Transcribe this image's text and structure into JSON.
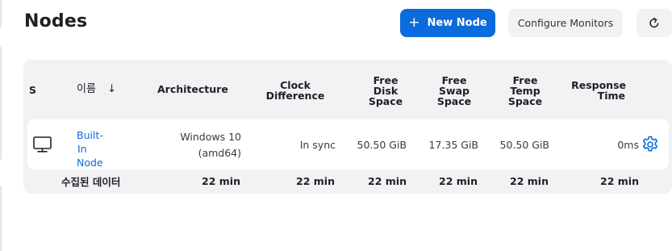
{
  "page": {
    "title": "Nodes"
  },
  "toolbar": {
    "new_node_label": "New Node",
    "new_node_icon": "plus-icon",
    "configure_monitors_label": "Configure Monitors",
    "refresh_icon": "refresh-icon"
  },
  "table": {
    "headers": {
      "status": "S",
      "name": "이름",
      "name_sort": "↓",
      "architecture": "Architecture",
      "clock_difference": [
        "Clock",
        "Difference"
      ],
      "free_disk_space": [
        "Free",
        "Disk",
        "Space"
      ],
      "free_swap_space": [
        "Free",
        "Swap",
        "Space"
      ],
      "free_temp_space": [
        "Free",
        "Temp",
        "Space"
      ],
      "response_time": [
        "Response",
        "Time"
      ]
    },
    "rows": [
      {
        "status_icon": "computer-icon",
        "name_lines": [
          "Built-",
          "In",
          "Node"
        ],
        "architecture_lines": [
          "Windows 10",
          "(amd64)"
        ],
        "clock_difference": "In sync",
        "free_disk_space": "50.50 GiB",
        "free_swap_space": "17.35 GiB",
        "free_temp_space": "50.50 GiB",
        "response_time": "0ms",
        "settings_icon": "gear-icon"
      }
    ],
    "footer": {
      "label": "수집된 데이터",
      "architecture": "22 min",
      "clock_difference": "22 min",
      "free_disk_space": "22 min",
      "free_swap_space": "22 min",
      "free_temp_space": "22 min",
      "response_time": "22 min"
    }
  },
  "colors": {
    "accent": "#0b6bdc",
    "surface": "#f2f2f5"
  }
}
